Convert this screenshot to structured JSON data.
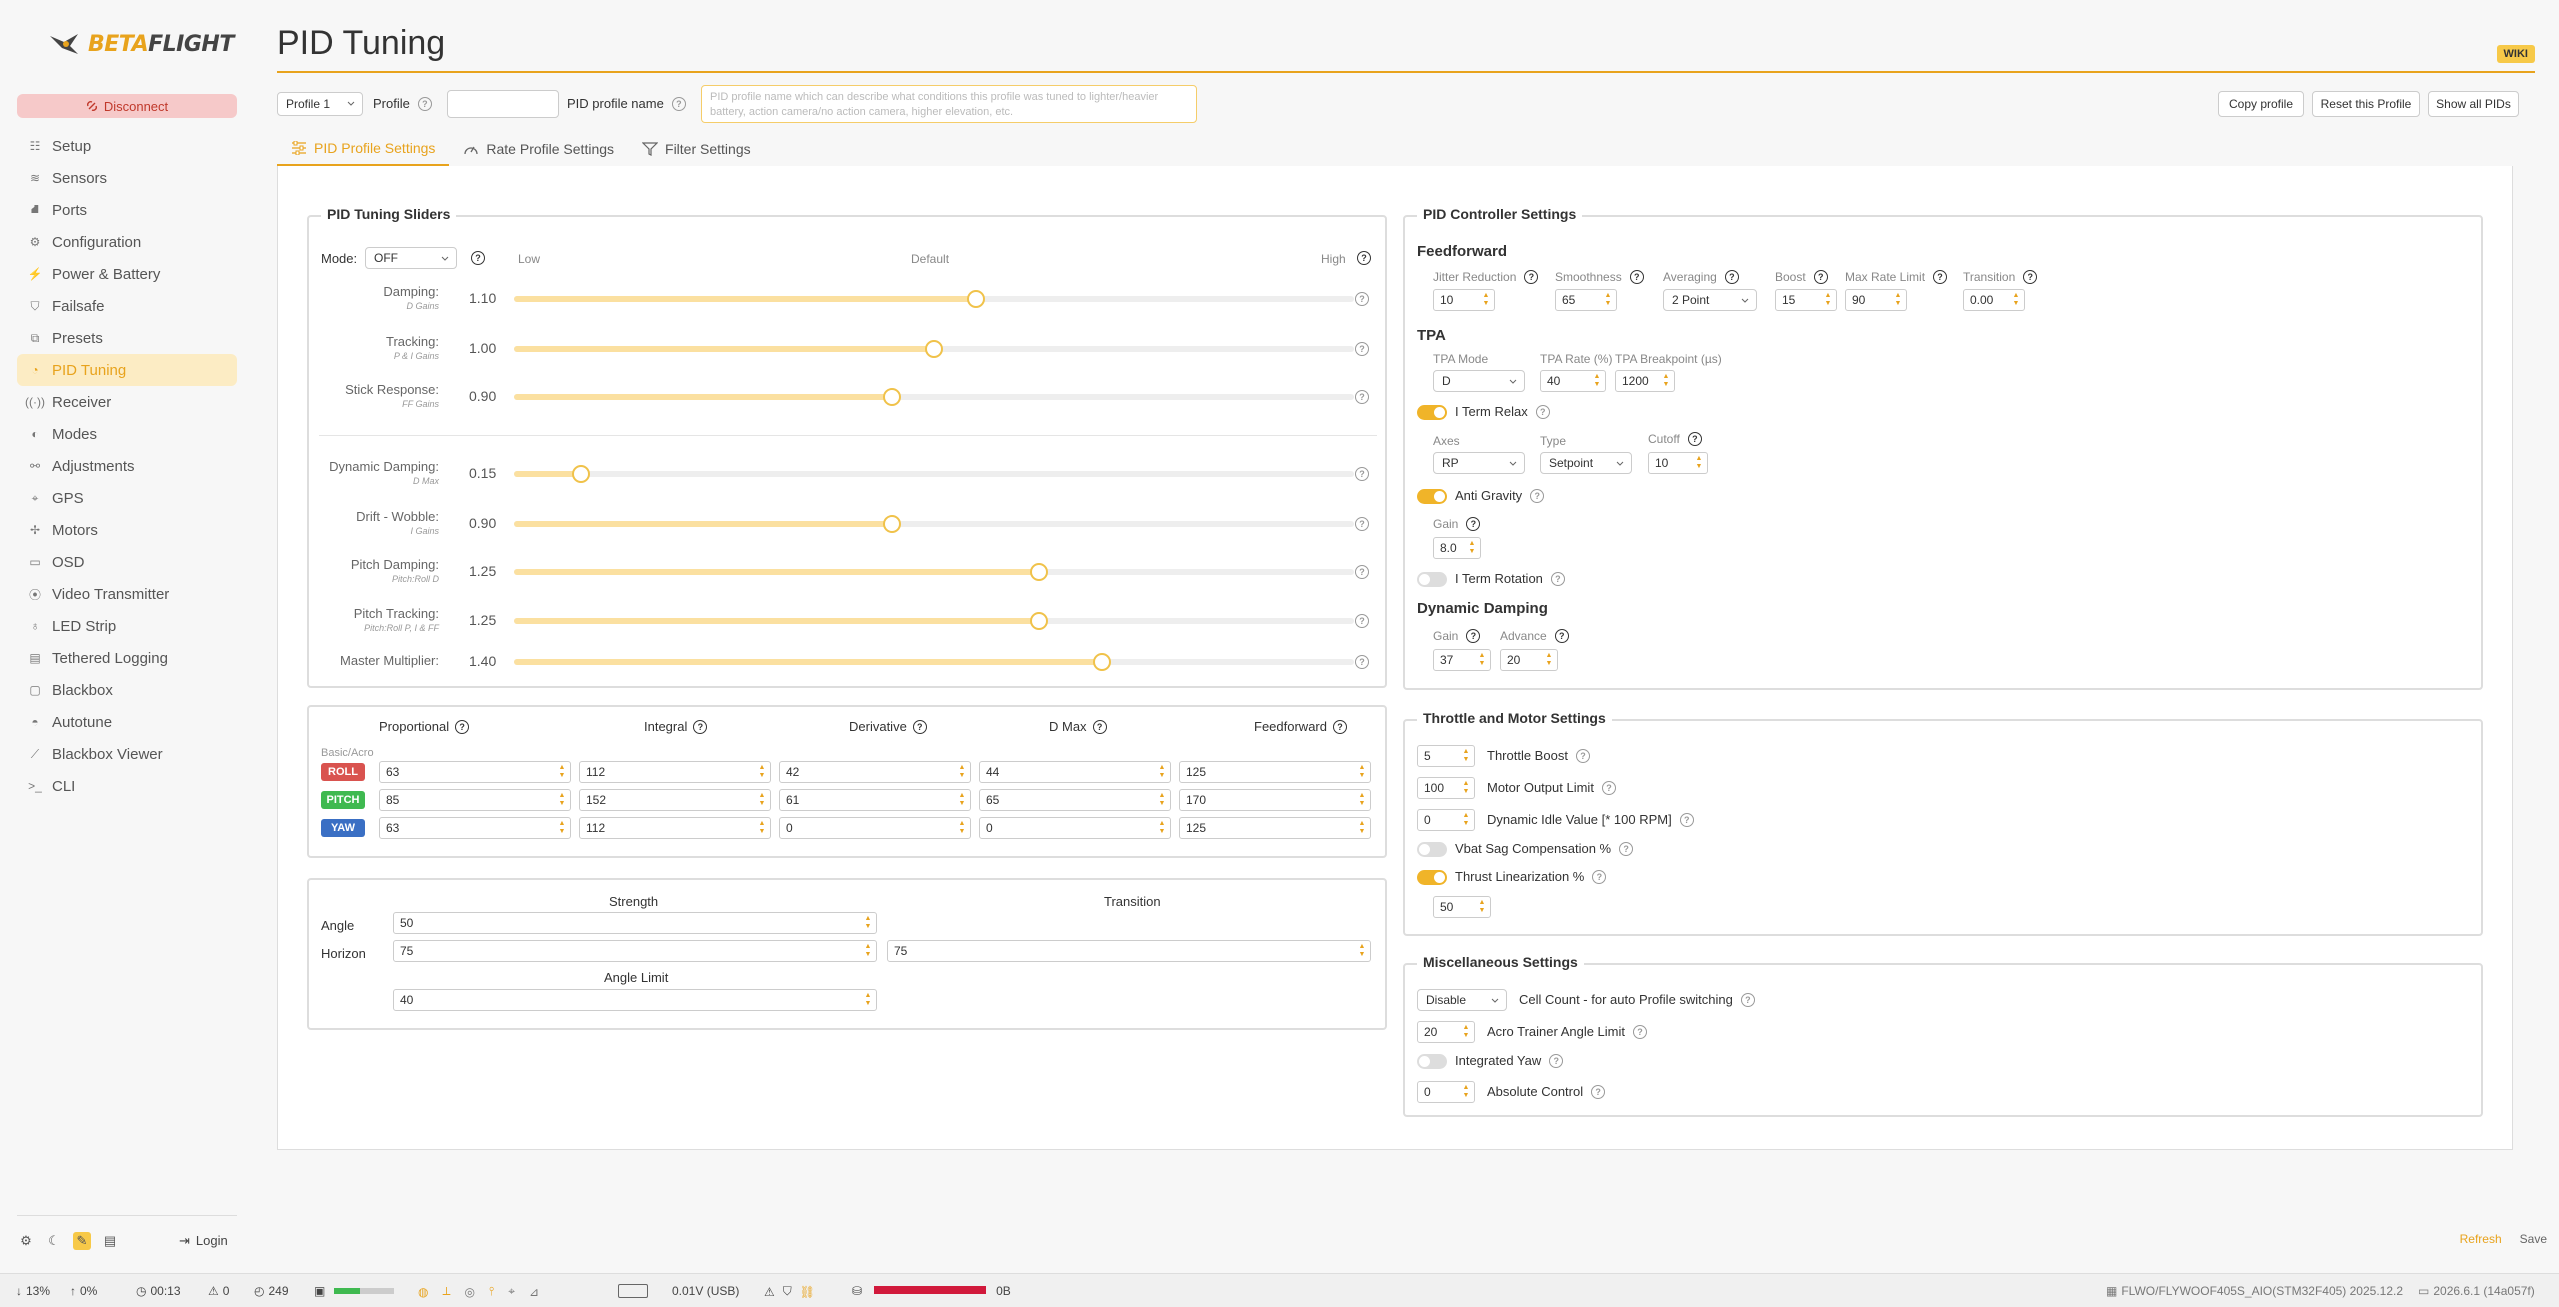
{
  "app": {
    "logo_text_a": "BETA",
    "logo_text_b": "FLIGHT",
    "disconnect": "Disconnect",
    "wiki": "WIKI",
    "login": "Login"
  },
  "nav": [
    {
      "label": "Setup",
      "icon": "setup-icon"
    },
    {
      "label": "Sensors",
      "icon": "sensors-icon"
    },
    {
      "label": "Ports",
      "icon": "ports-icon"
    },
    {
      "label": "Configuration",
      "icon": "gear-icon"
    },
    {
      "label": "Power & Battery",
      "icon": "power-icon"
    },
    {
      "label": "Failsafe",
      "icon": "shield-icon"
    },
    {
      "label": "Presets",
      "icon": "presets-icon"
    },
    {
      "label": "PID Tuning",
      "icon": "gauge-icon",
      "active": true
    },
    {
      "label": "Receiver",
      "icon": "receiver-icon"
    },
    {
      "label": "Modes",
      "icon": "toggle-icon"
    },
    {
      "label": "Adjustments",
      "icon": "adjustments-icon"
    },
    {
      "label": "GPS",
      "icon": "location-icon"
    },
    {
      "label": "Motors",
      "icon": "motors-icon"
    },
    {
      "label": "OSD",
      "icon": "monitor-icon"
    },
    {
      "label": "Video Transmitter",
      "icon": "antenna-icon"
    },
    {
      "label": "LED Strip",
      "icon": "bulb-icon"
    },
    {
      "label": "Tethered Logging",
      "icon": "notebook-icon"
    },
    {
      "label": "Blackbox",
      "icon": "box-icon"
    },
    {
      "label": "Autotune",
      "icon": "autotune-icon"
    },
    {
      "label": "Blackbox Viewer",
      "icon": "chart-icon"
    },
    {
      "label": "CLI",
      "icon": "terminal-icon"
    }
  ],
  "page": {
    "title": "PID Tuning"
  },
  "toolbar": {
    "profile_select": "Profile 1",
    "profile_label": "Profile",
    "profile_name_label": "PID profile name",
    "profile_name_placeholder": "PID profile name which can describe what conditions this profile was tuned to lighter/heavier battery, action camera/no action camera, higher elevation, etc.",
    "copy": "Copy profile",
    "reset": "Reset this Profile",
    "show_all": "Show all PIDs"
  },
  "tabs": [
    "PID Profile Settings",
    "Rate Profile Settings",
    "Filter Settings"
  ],
  "sliders_panel": {
    "title": "PID Tuning Sliders",
    "mode_label": "Mode:",
    "mode_value": "OFF",
    "low": "Low",
    "default": "Default",
    "high": "High",
    "rows": [
      {
        "label": "Damping:",
        "sub": "D Gains",
        "value": "1.10",
        "pct": 0.55
      },
      {
        "label": "Tracking:",
        "sub": "P & I Gains",
        "value": "1.00",
        "pct": 0.5
      },
      {
        "label": "Stick Response:",
        "sub": "FF Gains",
        "value": "0.90",
        "pct": 0.45
      },
      {
        "label": "Dynamic Damping:",
        "sub": "D Max",
        "value": "0.15",
        "pct": 0.08
      },
      {
        "label": "Drift - Wobble:",
        "sub": "I Gains",
        "value": "0.90",
        "pct": 0.45
      },
      {
        "label": "Pitch Damping:",
        "sub": "Pitch:Roll D",
        "value": "1.25",
        "pct": 0.625
      },
      {
        "label": "Pitch Tracking:",
        "sub": "Pitch:Roll P, I & FF",
        "value": "1.25",
        "pct": 0.625
      },
      {
        "label": "Master Multiplier:",
        "sub": "",
        "value": "1.40",
        "pct": 0.7
      }
    ]
  },
  "pid": {
    "headers": [
      "Proportional",
      "Integral",
      "Derivative",
      "D Max",
      "Feedforward"
    ],
    "sub": "Basic/Acro",
    "rows": [
      {
        "axis": "ROLL",
        "color": "#d9534f",
        "values": [
          "63",
          "112",
          "42",
          "44",
          "125"
        ]
      },
      {
        "axis": "PITCH",
        "color": "#3fb950",
        "values": [
          "85",
          "152",
          "61",
          "65",
          "170"
        ]
      },
      {
        "axis": "YAW",
        "color": "#3a6fc4",
        "values": [
          "63",
          "112",
          "0",
          "0",
          "125"
        ]
      }
    ]
  },
  "angle": {
    "strength": "Strength",
    "transition": "Transition",
    "angle_label": "Angle",
    "angle_val": "50",
    "horizon_label": "Horizon",
    "horizon_val": "75",
    "horizon_trans": "75",
    "limit_label": "Angle Limit",
    "limit_val": "40"
  },
  "pid_ctrl": {
    "title": "PID Controller Settings",
    "ff_head": "Feedforward",
    "ff": [
      {
        "label": "Jitter Reduction",
        "val": "10"
      },
      {
        "label": "Smoothness",
        "val": "65"
      },
      {
        "label": "Averaging",
        "val": "2 Point"
      },
      {
        "label": "Boost",
        "val": "15"
      },
      {
        "label": "Max Rate Limit",
        "val": "90"
      },
      {
        "label": "Transition",
        "val": "0.00"
      }
    ],
    "tpa_head": "TPA",
    "tpa_mode_label": "TPA Mode",
    "tpa_mode": "D",
    "tpa_rate_label": "TPA Rate (%)",
    "tpa_rate": "40",
    "tpa_bp_label": "TPA Breakpoint (µs)",
    "tpa_bp": "1200",
    "iterm_relax": "I Term Relax",
    "axes_label": "Axes",
    "axes": "RP",
    "type_label": "Type",
    "type": "Setpoint",
    "cutoff_label": "Cutoff",
    "cutoff": "10",
    "anti_gravity": "Anti Gravity",
    "gain_label": "Gain",
    "ag_gain": "8.0",
    "iterm_rot": "I Term Rotation",
    "dd_head": "Dynamic Damping",
    "dd_gain_label": "Gain",
    "dd_gain": "37",
    "dd_adv_label": "Advance",
    "dd_adv": "20"
  },
  "throttle": {
    "title": "Throttle and Motor Settings",
    "boost_val": "5",
    "boost": "Throttle Boost",
    "mol_val": "100",
    "mol": "Motor Output Limit",
    "dyn_val": "0",
    "dyn": "Dynamic Idle Value [* 100 RPM]",
    "vbat": "Vbat Sag Compensation %",
    "thrust": "Thrust Linearization %",
    "thrust_val": "50"
  },
  "misc": {
    "title": "Miscellaneous Settings",
    "cell_val": "Disable",
    "cell": "Cell Count - for auto Profile switching",
    "acro_val": "20",
    "acro": "Acro Trainer Angle Limit",
    "iyaw": "Integrated Yaw",
    "abs_val": "0",
    "abs": "Absolute Control"
  },
  "actions": {
    "refresh": "Refresh",
    "save": "Save"
  },
  "status": {
    "down": "13%",
    "up": "0%",
    "time": "00:13",
    "warn": "0",
    "cycle": "249",
    "volt": "0.01V (USB)",
    "bb": "0B",
    "fw": "FLWO/FLYWOOF405S_AIO(STM32F405) 2025.12.2",
    "ver": "2026.6.1 (14a057f)"
  }
}
